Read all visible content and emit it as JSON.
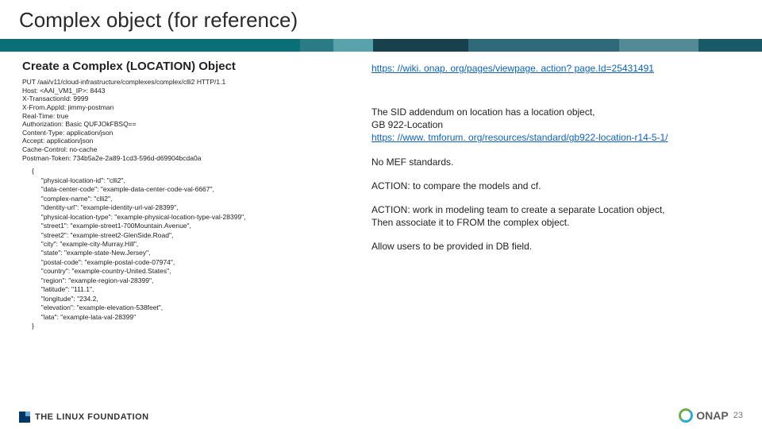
{
  "title": "Complex object (for reference)",
  "subhead": "Create a Complex (LOCATION) Object",
  "http_lines": [
    "PUT /aai/v11/cloud-infrastructure/complexes/complex/clli2 HTTP/1.1",
    "Host: <AAI_VM1_IP>: 8443",
    "X-TransactionId: 9999",
    "X-From.AppId: jimmy-postman",
    "Real-Time: true",
    "Authorization: Basic QUFJOkFBSQ==",
    "Content-Type: application/json",
    "Accept: application/json",
    "Cache-Control: no-cache",
    "Postman-Token: 734b5a2e-2a89-1cd3-596d-d69904bcda0a"
  ],
  "json_lines": [
    "{",
    "     \"physical-location-id\": \"clli2\",",
    "     \"data-center-code\": \"example-data-center-code-val-6667\",",
    "     \"complex-name\": \"clli2\",",
    "     \"identity-url\": \"example-identity-url-val-28399\",",
    "     \"physical-location-type\": \"example-physical-location-type-val-28399\",",
    "     \"street1\": \"example-street1-700Mountain.Avenue\",",
    "     \"street2\": \"example-street2-GlenSide.Road\",",
    "     \"city\": \"example-city-Murray.Hill\",",
    "     \"state\": \"example-state-New.Jersey\",",
    "     \"postal-code\": \"example-postal-code-07974\",",
    "     \"country\": \"example-country-United.States\",",
    "     \"region\": \"example-region-val-28399\",",
    "     \"latitude\": \"111.1\",",
    "     \"longitude\": \"234.2,",
    "     \"elevation\": \"example-elevation-538feet\",",
    "     \"lata\": \"example-lata-val-28399\"",
    "}"
  ],
  "wiki_link": "https: //wiki. onap. org/pages/viewpage. action? page.Id=25431491",
  "note_sid_1": "The SID addendum on location has a location object,",
  "note_sid_2": "GB 922-Location",
  "tmf_link": "https: //www. tmforum. org/resources/standard/gb922-location-r14-5-1/",
  "note_mef": "No MEF standards.",
  "action1": "ACTION: to compare the models and cf.",
  "action2_1": "ACTION: work in modeling team to create a separate Location object,",
  "action2_2": "Then associate it to FROM the complex object.",
  "note_db": "Allow users to be provided in DB field.",
  "lf_text": "THE LINUX FOUNDATION",
  "onap_text": "ONAP",
  "page_num": "23"
}
